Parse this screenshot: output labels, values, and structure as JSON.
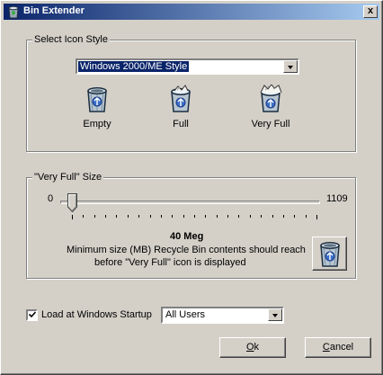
{
  "window": {
    "title": "Bin Extender",
    "close_glyph": "x"
  },
  "icon_style": {
    "legend": "Select Icon Style",
    "selected_style": "Windows 2000/ME Style",
    "options": [
      {
        "label": "Empty",
        "icon": "recycle-bin-empty-icon"
      },
      {
        "label": "Full",
        "icon": "recycle-bin-full-icon"
      },
      {
        "label": "Very Full",
        "icon": "recycle-bin-very-full-icon"
      }
    ]
  },
  "very_full": {
    "legend": "\"Very Full\" Size",
    "slider_min": "0",
    "slider_max": "1109",
    "slider_value": 40,
    "value_label": "40 Meg",
    "description_line1": "Minimum size (MB) Recycle Bin contents should reach",
    "description_line2": "before \"Very Full\" icon is displayed",
    "preview_icon": "recycle-bin-empty-icon"
  },
  "startup": {
    "checkbox_label": "Load at Windows Startup",
    "checked": true,
    "users_selected": "All Users"
  },
  "buttons": {
    "ok_label": "Ok",
    "ok_mnemonic_index": 0,
    "cancel_label": "Cancel",
    "cancel_mnemonic_index": 0
  },
  "colors": {
    "face": "#d4d0c8",
    "title_start": "#0a246a",
    "title_end": "#a6caf0",
    "selection": "#0a246a"
  }
}
